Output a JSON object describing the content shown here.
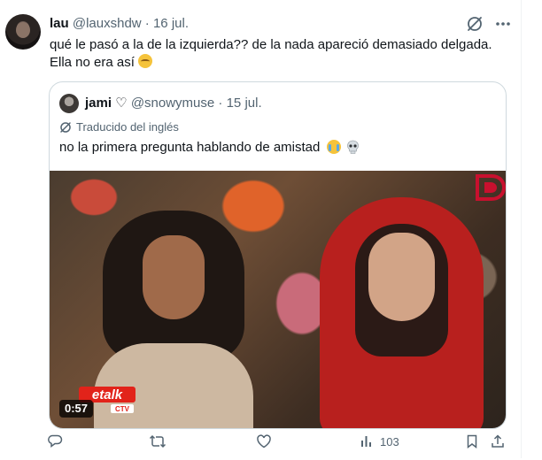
{
  "tweet": {
    "author_name": "lau",
    "handle": "@lauxshdw",
    "separator": "·",
    "date": "16 jul.",
    "text": "qué le pasó a la de la izquierda?? de la nada apareció demasiado delgada. Ella no era así"
  },
  "quote": {
    "author_name": "jami",
    "heart_symbol": "♡",
    "handle": "@snowymuse",
    "separator": "·",
    "date": "15 jul.",
    "translated_label": "Traducido del inglés",
    "text": "no la primera pregunta hablando de amistad",
    "video": {
      "duration": "0:57",
      "logo_text": "etalk",
      "network_text": "CTV"
    }
  },
  "actions": {
    "views": "103"
  },
  "colors": {
    "text_primary": "#0f1419",
    "text_secondary": "#536471",
    "border": "#cfd9de",
    "etalk_red": "#e2231a"
  },
  "icons": [
    "grok-icon",
    "more-icon",
    "translate-icon",
    "reply-icon",
    "retweet-icon",
    "like-icon",
    "views-icon",
    "bookmark-icon",
    "share-icon"
  ]
}
